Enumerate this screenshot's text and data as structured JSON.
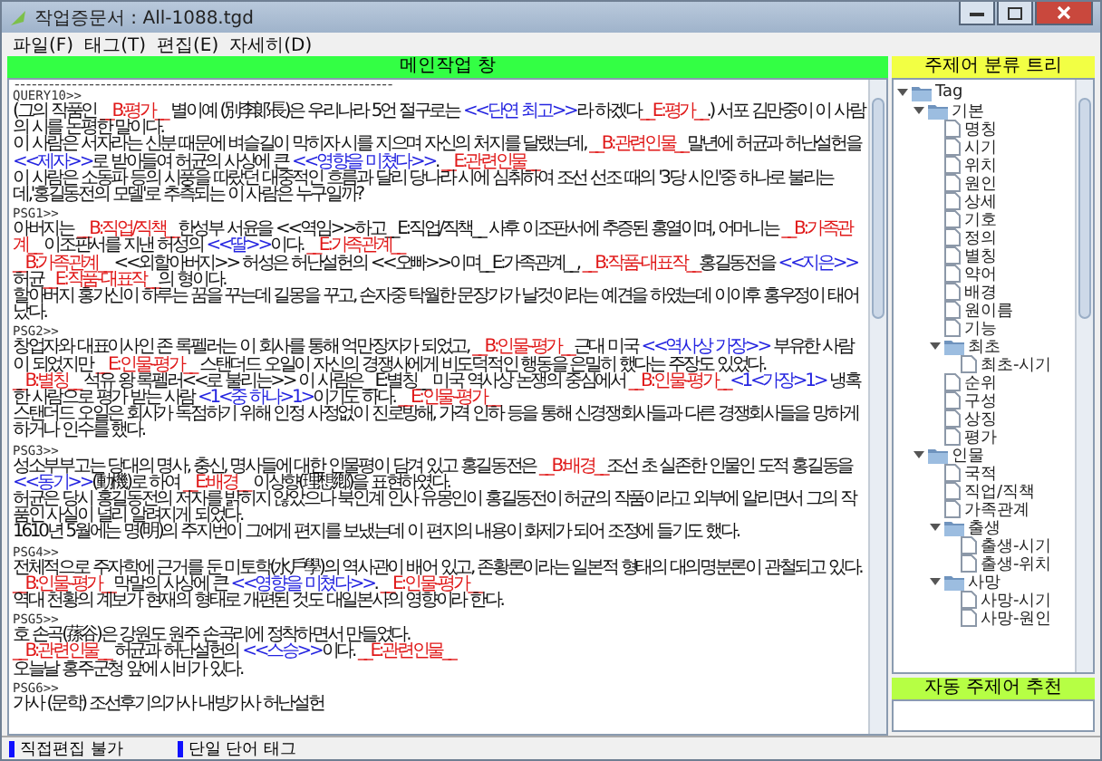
{
  "window": {
    "title": "작업증문서 : All-1088.tgd"
  },
  "menu": [
    "파일(F)",
    "태그(T)",
    "편집(E)",
    "자세히(D)"
  ],
  "main_panel": {
    "title": "메인작업 창",
    "blocks": [
      {
        "kind": "rule",
        "text": "------------------------------------------------------------------"
      },
      {
        "kind": "label",
        "text": "QUERY10>>"
      },
      {
        "kind": "para",
        "segments": [
          {
            "kind": "plain",
            "text": "(그의 작품인 "
          },
          {
            "kind": "tag",
            "text": "__B:평가__"
          },
          {
            "kind": "plain",
            "text": " 별이예 (別李郞長)은 우리나라 5언 절구로는 "
          },
          {
            "kind": "mark",
            "text": "<<단연 최고>>"
          },
          {
            "kind": "plain",
            "text": "라 하겠다"
          },
          {
            "kind": "tag",
            "text": "__E:평가__"
          },
          {
            "kind": "plain",
            "text": ".) 서포 김만중이 이 사람의 시를 논평한 말이다."
          }
        ]
      },
      {
        "kind": "para",
        "segments": [
          {
            "kind": "plain",
            "text": "이 사람은 서자라는 신분 때문에 벼슬길이 막히자 시를 지으며 자신의 처지를 달랬는데, "
          },
          {
            "kind": "tag",
            "text": "__B:관련인물__"
          },
          {
            "kind": "plain",
            "text": "말년에 허균과 허난설헌을 "
          },
          {
            "kind": "mark",
            "text": "<<제자>>"
          },
          {
            "kind": "plain",
            "text": "로 받아들여 허균의 사상에 큰 "
          },
          {
            "kind": "mark",
            "text": "<<영향을 미쳤다>>"
          },
          {
            "kind": "plain",
            "text": ". "
          },
          {
            "kind": "tag",
            "text": "__E:관련인물__"
          }
        ]
      },
      {
        "kind": "para",
        "segments": [
          {
            "kind": "plain",
            "text": "이 사람은 소동파 등의 시풍을 따랐던 대중적인 흐름과 달리 당나라 시에 심취하여 조선 선조 때의 '3당 시인'중 하나로 불리는데,'홍길동전의 모델'로 추측되는 이 사람은 누구일까?"
          }
        ]
      },
      {
        "kind": "label",
        "text": "PSG1>>"
      },
      {
        "kind": "para",
        "segments": [
          {
            "kind": "plain",
            "text": "아버지는 "
          },
          {
            "kind": "tag",
            "text": "__B:직업/직책__"
          },
          {
            "kind": "plain",
            "text": "한성부 서윤을 <<역임>>하고__E:직업/직책__ 사후 이조판서에 추증된 홍열이며, 어머니는 "
          },
          {
            "kind": "tag",
            "text": "__B:가족관계__"
          },
          {
            "kind": "plain",
            "text": " 이조판서를 지낸 허성의 "
          },
          {
            "kind": "mark",
            "text": "<<딸>>"
          },
          {
            "kind": "plain",
            "text": "이다. "
          },
          {
            "kind": "tag",
            "text": "__E:가족관계__"
          }
        ]
      },
      {
        "kind": "para",
        "segments": [
          {
            "kind": "tag",
            "text": "__B:가족관계__"
          },
          {
            "kind": "plain",
            "text": " <<외할아버지>> 허성은 허난설헌의 <<오빠>>이며__E:가족관계__, "
          },
          {
            "kind": "tag",
            "text": "__B:작품-대표작__"
          },
          {
            "kind": "plain",
            "text": "홍길동전을 "
          },
          {
            "kind": "mark",
            "text": "<<지은>>"
          },
          {
            "kind": "plain",
            "text": " 허균"
          },
          {
            "kind": "tag",
            "text": "__E:작품-대표작__"
          },
          {
            "kind": "plain",
            "text": "의 형이다."
          }
        ]
      },
      {
        "kind": "para",
        "segments": [
          {
            "kind": "plain",
            "text": "할아버지 홍가신이 하루는 꿈을 꾸는데 길몽을 꾸고, 손자중 탁월한 문장가가 날것이라는 예견을 하였는데 이이후 홍우정이 태어 났다."
          }
        ]
      },
      {
        "kind": "label",
        "text": "PSG2>>"
      },
      {
        "kind": "para",
        "segments": [
          {
            "kind": "plain",
            "text": "창업자와 대표이사인 존 록펠러는 이 회사를 통해 억만장자가 되었고, "
          },
          {
            "kind": "tag",
            "text": "__B:인물-평가__"
          },
          {
            "kind": "plain",
            "text": "근대 미국 "
          },
          {
            "kind": "mark",
            "text": "<<역사상 가장>>"
          },
          {
            "kind": "plain",
            "text": " 부유한 사람이 되었지만 "
          },
          {
            "kind": "tag",
            "text": "__E:인물-평가__"
          },
          {
            "kind": "plain",
            "text": " 스탠더드 오일이 자신의 경쟁사에게 비도덕적인 행동을 은밀히 했다는 주장도 있었다."
          }
        ]
      },
      {
        "kind": "para",
        "segments": [
          {
            "kind": "tag",
            "text": "__B:별칭__"
          },
          {
            "kind": "plain",
            "text": " 석유 왕 록펠러<<로 불리는>> 이 사람은__E:별칭__ 미국 역사상 논쟁의 중심에서 "
          },
          {
            "kind": "tag",
            "text": "__B:인물-평가__"
          },
          {
            "kind": "mark",
            "text": "<1<가장>1>"
          },
          {
            "kind": "plain",
            "text": " 냉혹한 사람으로 평가 받는 사람 "
          },
          {
            "kind": "mark",
            "text": "<1<중 하나>1>"
          },
          {
            "kind": "plain",
            "text": "이기도 하다. "
          },
          {
            "kind": "tag",
            "text": "__E:인물-평가__"
          }
        ]
      },
      {
        "kind": "para",
        "segments": [
          {
            "kind": "plain",
            "text": "스탠더드 오일은 회사가 독점하기 위해 인정 사정없이 진로방해, 가격 인하 등을 통해 신경쟁회사들과 다른 경쟁회사들을 망하게 하거나 인수를 했다."
          }
        ]
      },
      {
        "kind": "label",
        "text": "PSG3>>"
      },
      {
        "kind": "para",
        "segments": [
          {
            "kind": "plain",
            "text": "성소부부고는 당대의 명사, 충신, 명사들에 대한 인물평이 담겨 있고 홍길동전은 "
          },
          {
            "kind": "tag",
            "text": "__B:배경__"
          },
          {
            "kind": "plain",
            "text": "조선 초 실존한 인물인 도적 홍길동을 "
          },
          {
            "kind": "mark",
            "text": "<<동기>>"
          },
          {
            "kind": "plain",
            "text": "(動機)로 하여 "
          },
          {
            "kind": "tag",
            "text": "__E:배경__"
          },
          {
            "kind": "plain",
            "text": " 이상향(理想鄕)을 표현하였다."
          }
        ]
      },
      {
        "kind": "para",
        "segments": [
          {
            "kind": "plain",
            "text": "허균은 당시 홍길동전의 저자를 밝히지 않았으나 북인계 인사 유몽인이 홍길동전이 허균의 작품이라고 외부에 알리면서 그의 작품인 사실이 널리 알려지게 되었다."
          }
        ]
      },
      {
        "kind": "para",
        "segments": [
          {
            "kind": "plain",
            "text": "1610년 5월에는 명(明)의 주지번이 그에게 편지를 보냈는데 이 편지의 내용이 화제가 되어 조정에 들기도 했다."
          }
        ]
      },
      {
        "kind": "label",
        "text": "PSG4>>"
      },
      {
        "kind": "para",
        "segments": [
          {
            "kind": "plain",
            "text": "전체적으로 주자학에 근거를 둔 미토학(水戶學)의 역사관이 배어 있고, 존황론이라는 일본적 형태의 대의명분론이 관철되고 있다."
          }
        ]
      },
      {
        "kind": "para",
        "segments": [
          {
            "kind": "tag",
            "text": "__B:인물-평가__"
          },
          {
            "kind": "plain",
            "text": "막말의 사상에 큰 "
          },
          {
            "kind": "mark",
            "text": "<<영향을 미쳤다>>"
          },
          {
            "kind": "plain",
            "text": ". "
          },
          {
            "kind": "tag",
            "text": "__E:인물-평가__"
          }
        ]
      },
      {
        "kind": "para",
        "segments": [
          {
            "kind": "plain",
            "text": "역대 천황의 계보가 현재의 형태로 개편된 것도 대일본사의 영향이라 한다."
          }
        ]
      },
      {
        "kind": "label",
        "text": "PSG5>>"
      },
      {
        "kind": "para",
        "segments": [
          {
            "kind": "plain",
            "text": "호 손곡(蓀谷)은 강원도 원주 손곡리에 정착하면서 만들었다."
          }
        ]
      },
      {
        "kind": "para",
        "segments": [
          {
            "kind": "tag",
            "text": "__B:관련인물__"
          },
          {
            "kind": "plain",
            "text": " 허균과 허난설헌의 "
          },
          {
            "kind": "mark",
            "text": "<<스승>>"
          },
          {
            "kind": "plain",
            "text": "이다. "
          },
          {
            "kind": "tag",
            "text": "__E:관련인물__"
          }
        ]
      },
      {
        "kind": "para",
        "segments": [
          {
            "kind": "plain",
            "text": "오늘날 홍주군청 앞에 시비가 있다."
          }
        ]
      },
      {
        "kind": "label",
        "text": "PSG6>>"
      },
      {
        "kind": "para",
        "segments": [
          {
            "kind": "plain",
            "text": "가사 (문학) 조선후기의가사 내방가사 허난설헌"
          }
        ]
      }
    ]
  },
  "tree_panel": {
    "title": "주제어 분류 트리",
    "nodes": [
      {
        "label": "Tag",
        "kind": "folder",
        "expanded": true,
        "children": [
          {
            "label": "기본",
            "kind": "folder",
            "expanded": true,
            "children": [
              {
                "label": "명칭",
                "kind": "file"
              },
              {
                "label": "시기",
                "kind": "file"
              },
              {
                "label": "위치",
                "kind": "file"
              },
              {
                "label": "원인",
                "kind": "file"
              },
              {
                "label": "상세",
                "kind": "file"
              },
              {
                "label": "기호",
                "kind": "file"
              },
              {
                "label": "정의",
                "kind": "file"
              },
              {
                "label": "별칭",
                "kind": "file"
              },
              {
                "label": "약어",
                "kind": "file"
              },
              {
                "label": "배경",
                "kind": "file"
              },
              {
                "label": "원이름",
                "kind": "file"
              },
              {
                "label": "기능",
                "kind": "file"
              },
              {
                "label": "최초",
                "kind": "folder",
                "expanded": true,
                "children": [
                  {
                    "label": "최초-시기",
                    "kind": "file"
                  }
                ]
              },
              {
                "label": "순위",
                "kind": "file"
              },
              {
                "label": "구성",
                "kind": "file"
              },
              {
                "label": "상징",
                "kind": "file"
              },
              {
                "label": "평가",
                "kind": "file"
              }
            ]
          },
          {
            "label": "인물",
            "kind": "folder",
            "expanded": true,
            "children": [
              {
                "label": "국적",
                "kind": "file"
              },
              {
                "label": "직업/직책",
                "kind": "file"
              },
              {
                "label": "가족관계",
                "kind": "file"
              },
              {
                "label": "출생",
                "kind": "folder",
                "expanded": true,
                "children": [
                  {
                    "label": "출생-시기",
                    "kind": "file"
                  },
                  {
                    "label": "출생-위치",
                    "kind": "file"
                  }
                ]
              },
              {
                "label": "사망",
                "kind": "folder",
                "expanded": true,
                "children": [
                  {
                    "label": "사망-시기",
                    "kind": "file"
                  },
                  {
                    "label": "사망-원인",
                    "kind": "file"
                  }
                ]
              }
            ]
          }
        ]
      }
    ]
  },
  "suggest_panel": {
    "title": "자동 주제어 추천"
  },
  "status_bar": [
    "직접편집 불가",
    "단일 단어 태그"
  ]
}
